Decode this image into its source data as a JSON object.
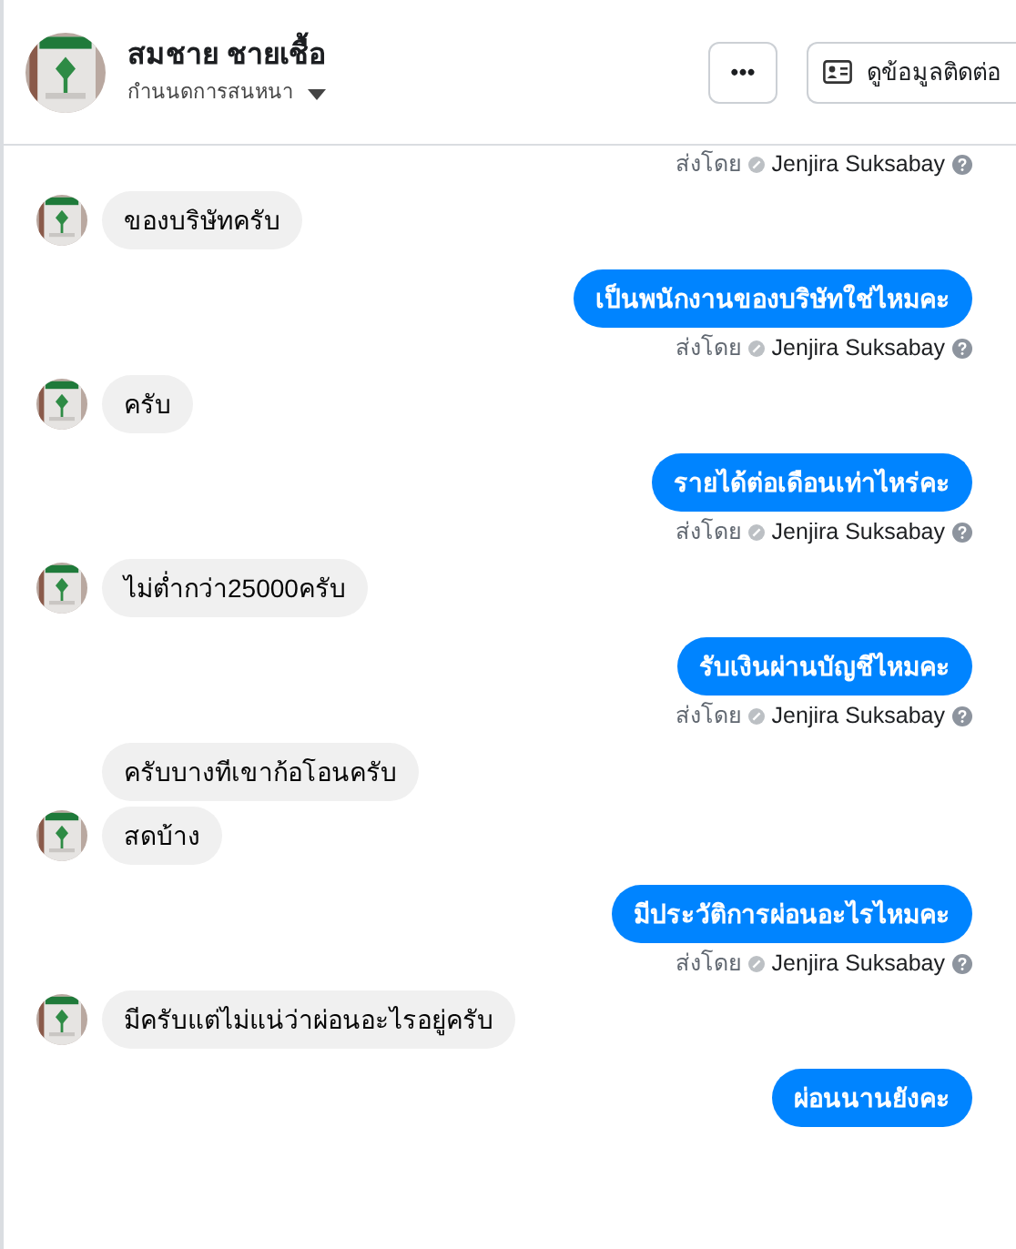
{
  "header": {
    "name": "สมชาย ชายเชื้อ",
    "subtitle": "กำนนดการสนหนา",
    "more_button": "•••",
    "contact_button": "ดูข้อมูลติดต่อ"
  },
  "messages": [
    {
      "kind": "sent_by",
      "sent_by": {
        "label": "ส่งโดย",
        "name": "Jenjira Suksabay"
      }
    },
    {
      "kind": "incoming",
      "text": "ของบริษัทครับ",
      "avatar": true
    },
    {
      "kind": "outgoing",
      "text": "เป็นพนักงานของบริษัทใช่ไหมคะ",
      "sent_by": {
        "label": "ส่งโดย",
        "name": "Jenjira Suksabay"
      }
    },
    {
      "kind": "incoming",
      "text": "ครับ",
      "avatar": true
    },
    {
      "kind": "outgoing",
      "text": "รายได้ต่อเดือนเท่าไหร่คะ",
      "sent_by": {
        "label": "ส่งโดย",
        "name": "Jenjira Suksabay"
      }
    },
    {
      "kind": "incoming",
      "text": "ไม่ต่ำกว่า25000ครับ",
      "avatar": true
    },
    {
      "kind": "outgoing",
      "text": "รับเงินผ่านบัญชีไหมคะ",
      "sent_by": {
        "label": "ส่งโดย",
        "name": "Jenjira Suksabay"
      }
    },
    {
      "kind": "incoming",
      "text": "ครับบางทีเขาก้อโอนครับ",
      "avatar": false
    },
    {
      "kind": "incoming",
      "text": "สดบ้าง",
      "avatar": true
    },
    {
      "kind": "outgoing",
      "text": "มีประวัติการผ่อนอะไรไหมคะ",
      "sent_by": {
        "label": "ส่งโดย",
        "name": "Jenjira Suksabay"
      }
    },
    {
      "kind": "incoming",
      "text": "มีครับแต่ไม่แน่ว่าผ่อนอะไรอยู่ครับ",
      "avatar": true
    },
    {
      "kind": "outgoing",
      "text": "ผ่อนนานยังคะ"
    }
  ]
}
